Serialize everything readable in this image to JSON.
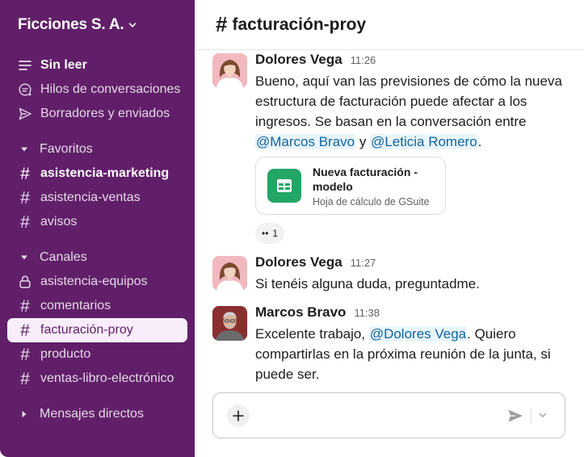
{
  "workspace": {
    "name": "Ficciones S. A."
  },
  "sidebar": {
    "top_items": [
      {
        "label": "Sin leer",
        "icon": "unread-icon"
      },
      {
        "label": "Hilos de conversaciones",
        "icon": "threads-icon"
      },
      {
        "label": "Borradores y enviados",
        "icon": "send-icon"
      }
    ],
    "favorites": {
      "label": "Favoritos",
      "items": [
        {
          "label": "asistencia-marketing"
        },
        {
          "label": "asistencia-ventas"
        },
        {
          "label": "avisos"
        }
      ]
    },
    "channels": {
      "label": "Canales",
      "items": [
        {
          "label": "asistencia-equipos",
          "icon": "lock-icon"
        },
        {
          "label": "comentarios"
        },
        {
          "label": "facturación-proy"
        },
        {
          "label": "producto"
        },
        {
          "label": "ventas-libro-electrónico"
        }
      ]
    },
    "direct_messages": {
      "label": "Mensajes directos"
    }
  },
  "channel": {
    "symbol": "#",
    "name": "facturación-proy"
  },
  "messages": [
    {
      "author": "Dolores Vega",
      "time": "11:26",
      "text_before": "Bueno, aquí van las previsiones de cómo la nueva estructura de facturación puede afectar a los ingresos. Se basan en la conversación entre ",
      "mention_1": "@Marcos Bravo",
      "text_between": " y ",
      "mention_2": "@Leticia Romero",
      "text_after": ".",
      "attachment": {
        "title": "Nueva facturación - modelo",
        "subtitle": "Hoja de cálculo de GSuite"
      },
      "reaction": {
        "emoji": "••",
        "count": "1"
      }
    },
    {
      "author": "Dolores Vega",
      "time": "11:27",
      "text": "Si tenéis alguna duda, preguntadme."
    },
    {
      "author": "Marcos Bravo",
      "time": "11:38",
      "text_before": "Excelente trabajo, ",
      "mention": "@Dolores Vega",
      "text_after": ". Quiero compartirlas en la próxima reunión de la junta, si puede ser."
    }
  ],
  "composer": {
    "placeholder": ""
  },
  "colors": {
    "sidebar": "#611f69",
    "active_item": "#f9edfb",
    "mention": "#1264a3",
    "sheet_icon": "#23a566"
  }
}
